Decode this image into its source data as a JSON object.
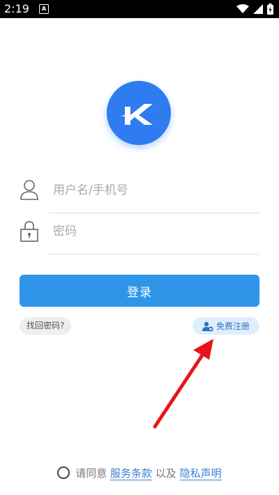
{
  "status_bar": {
    "time": "2:19",
    "notification_letter": "A",
    "icons": [
      "wifi-icon",
      "signal-icon",
      "battery-icon"
    ]
  },
  "logo": {
    "letter": "K",
    "color": "#2f7bf0"
  },
  "form": {
    "username_placeholder": "用户名/手机号",
    "username_value": "",
    "password_placeholder": "密码",
    "password_value": ""
  },
  "actions": {
    "login_label": "登录",
    "forgot_label": "找回密码?",
    "register_label": "免费注册"
  },
  "agreement": {
    "prefix": "请同意",
    "terms_label": "服务条款",
    "joiner": "以及",
    "privacy_label": "隐私声明"
  },
  "colors": {
    "primary": "#2f95e9",
    "register_bg": "#dfeefc",
    "link": "#3a7fd6",
    "annotation_arrow": "#e8141b"
  }
}
